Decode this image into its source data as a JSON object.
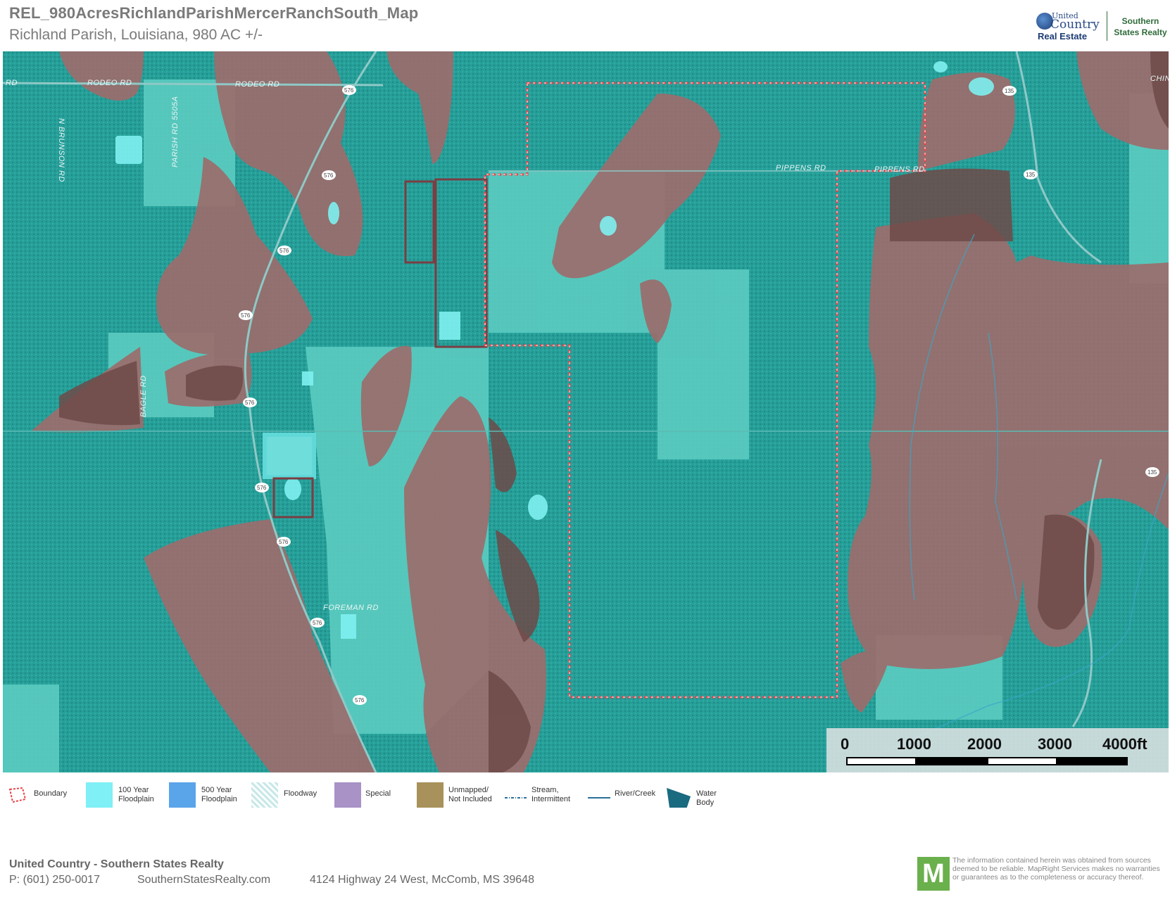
{
  "header": {
    "title": "REL_980AcresRichlandParishMercerRanchSouth_Map",
    "subtitle": "Richland Parish, Louisiana, 980 AC +/-"
  },
  "logo": {
    "united": "United",
    "country": "Country",
    "real_estate": "Real Estate",
    "southern": "Southern",
    "states_realty": "States Realty"
  },
  "map": {
    "road_labels": {
      "rd_left": "RD",
      "rodeo_rd_1": "RODEO RD",
      "rodeo_rd_2": "RODEO RD",
      "n_brunson_rd": "N BRUNSON RD",
      "parish_rd": "PARISH RD 5505A",
      "pippens_rd": "PIPPENS RD",
      "pippens_rd_2": "PIPPENS RD",
      "bagle_rd": "BAGLE RD",
      "foreman_rd": "FOREMAN RD",
      "chin": "CHIN"
    },
    "shields": [
      "576",
      "576",
      "576",
      "576",
      "576",
      "576",
      "576",
      "576",
      "576",
      "135",
      "135",
      "135"
    ],
    "colors": {
      "floodplain_100": "#2aa6a0",
      "agricultural_overlay": "#9b6b6b",
      "boundary": "#e8424a"
    }
  },
  "scale_bar": {
    "labels": [
      "0",
      "1000",
      "2000",
      "3000",
      "4000ft"
    ]
  },
  "legend": {
    "items": [
      {
        "label": "Boundary",
        "color": "#e8424a",
        "icon": "boundary-outline"
      },
      {
        "label": "100 Year\nFloodplain",
        "color": "#7ff0f5"
      },
      {
        "label": "500 Year\nFloodplain",
        "color": "#5aa4ea"
      },
      {
        "label": "Floodway",
        "color": "#c8e8e8",
        "icon": "hatched"
      },
      {
        "label": "Special",
        "color": "#a892c6"
      },
      {
        "label": "Unmapped/\nNot Included",
        "color": "#a8915a"
      },
      {
        "label": "Stream,\nIntermittent",
        "color": "#2a6f9a",
        "icon": "dashed-line"
      },
      {
        "label": "River/Creek",
        "color": "#2a6f9a",
        "icon": "solid-line"
      },
      {
        "label": "Water Body",
        "color": "#1a6a80",
        "icon": "water-body"
      }
    ]
  },
  "footer": {
    "company": "United Country - Southern States Realty",
    "phone": "P: (601) 250-0017",
    "website": "SouthernStatesRealty.com",
    "address": "4124 Highway 24 West, McComb, MS 39648",
    "badge": "M",
    "disclaimer": "The information contained herein was obtained from sources deemed to be reliable. MapRight Services makes no warranties or guarantees as to the completeness or accuracy thereof."
  }
}
